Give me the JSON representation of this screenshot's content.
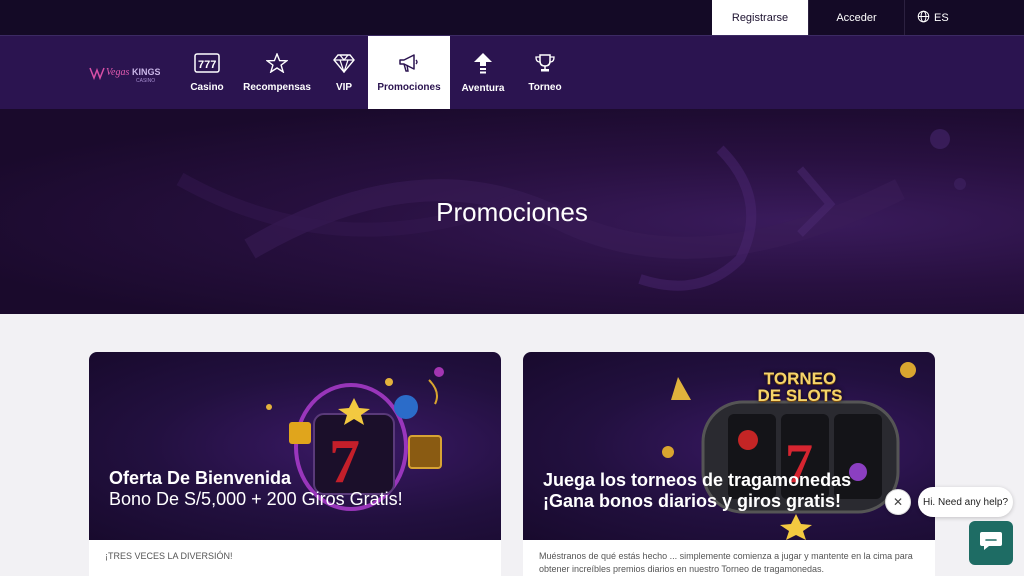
{
  "topbar": {
    "register_label": "Registrarse",
    "login_label": "Acceder",
    "language": "ES"
  },
  "nav": {
    "items": [
      {
        "label": "Casino",
        "icon": "slot-machine-icon"
      },
      {
        "label": "Recompensas",
        "icon": "star-icon"
      },
      {
        "label": "VIP",
        "icon": "diamond-icon"
      },
      {
        "label": "Promociones",
        "icon": "megaphone-icon"
      },
      {
        "label": "Aventura",
        "icon": "arrow-up-icon"
      },
      {
        "label": "Torneo",
        "icon": "trophy-icon"
      }
    ],
    "active": "Promociones"
  },
  "hero": {
    "title": "Promociones"
  },
  "cards": [
    {
      "heading_line1": "Oferta De Bienvenida",
      "heading_line2": "Bono De S/5,000 + 200 Giros Gratis!",
      "text": "¡TRES VECES LA DIVERSIÓN!"
    },
    {
      "image_title_line1": "TORNEO",
      "image_title_line2": "DE SLOTS",
      "heading_line1": "Juega los torneos de tragamonedas",
      "heading_line2": "¡Gana bonos diarios y giros gratis!",
      "text": "Muéstranos de qué estás hecho ... simplemente comienza a jugar y mantente en la cima para obtener increíbles premios diarios en nuestro Torneo de tragamonedas."
    }
  ],
  "chat": {
    "greeting": "Hi. Need any help?"
  },
  "colors": {
    "topbar": "#140a26",
    "nav": "#2b1450",
    "hero": "#1f0d33",
    "chat_button": "#1e6c64"
  }
}
